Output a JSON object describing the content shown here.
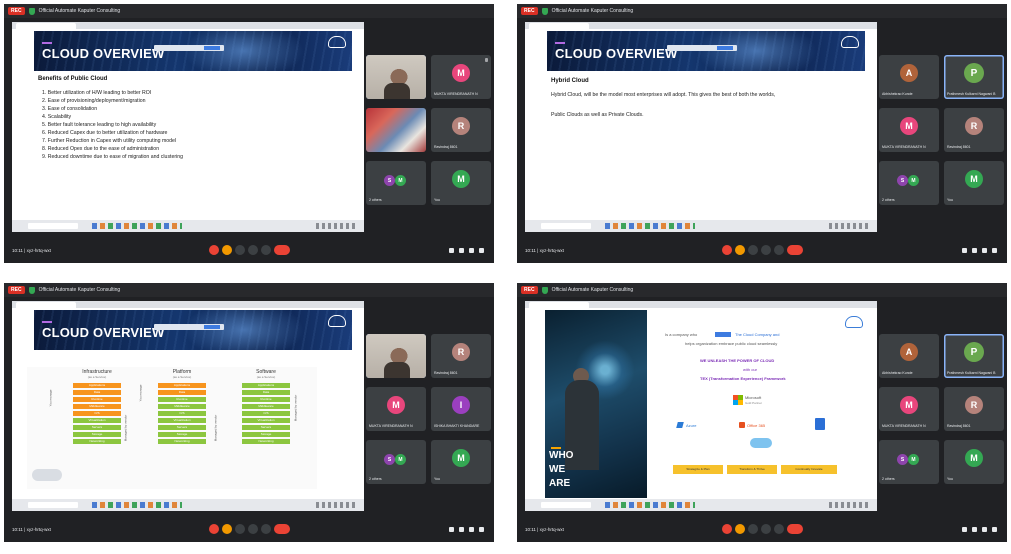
{
  "meeting": {
    "rec_label": "REC",
    "title": "Official Automate Kaputer Consulting",
    "time": "10:11  |  xyz-hrtq-wxt"
  },
  "panels": [
    {
      "slide_title": "CLOUD OVERVIEW",
      "heading": "Benefits of Public Cloud",
      "bullets": [
        "1. Better utilization of H/W leading to better ROI",
        "2. Ease of provisioning/deployment/migration",
        "3. Ease of consolidation",
        "4. Scalability",
        "5. Better fault tolerance leading to high availability",
        "6. Reduced Capex due to better utilization of hardware",
        "7. Further Reduction in Capex with utility computing model",
        "8. Reduced Opex due to the ease of administration",
        "9. Reduced downtime due to ease of migration and clustering"
      ],
      "participants": [
        {
          "name": "",
          "type": "video"
        },
        {
          "initial": "M",
          "name": "MUKTA VIRENDRANATH N",
          "color": "#e8467c"
        },
        {
          "name": "",
          "type": "video2"
        },
        {
          "initial": "R",
          "name": "Ravindraj 8601",
          "color": "#b5837b"
        },
        {
          "initial": "S",
          "initial2": "M",
          "name": "2 others",
          "color": "#8e44ad"
        },
        {
          "initial": "M",
          "name": "You",
          "color": "#34a853"
        }
      ]
    },
    {
      "slide_title": "CLOUD OVERVIEW",
      "heading": "Hybrid Cloud",
      "paragraphs": [
        "Hybrid Cloud, will be the model most enterprises will adopt. This gives the best of both the worlds,",
        "Public Clouds as well as Private Clouds."
      ],
      "participants": [
        {
          "initial": "A",
          "name": "Abhishekrao Kunde",
          "color": "#b0633a"
        },
        {
          "initial": "P",
          "name": "Prathmesh Kulkarni Nagwani B",
          "color": "#6aa84f"
        },
        {
          "initial": "M",
          "name": "MUKTA VIRENDRANATH N",
          "color": "#e8467c"
        },
        {
          "initial": "R",
          "name": "Ravindraj 8601",
          "color": "#b5837b"
        },
        {
          "initial": "S",
          "initial2": "M",
          "name": "2 others",
          "color": "#8e44ad"
        },
        {
          "initial": "M",
          "name": "You",
          "color": "#34a853"
        }
      ]
    },
    {
      "slide_title": "CLOUD OVERVIEW",
      "columns": [
        {
          "head": "Infrastructure",
          "sub": "(as a Service)",
          "items": [
            "Applications",
            "Data",
            "Runtime",
            "Middleware",
            "O/S",
            "Virtualization",
            "Servers",
            "Storage",
            "Networking"
          ],
          "orange_count": 5
        },
        {
          "head": "Platform",
          "sub": "(as a Service)",
          "items": [
            "Applications",
            "Data",
            "Runtime",
            "Middleware",
            "O/S",
            "Virtualization",
            "Servers",
            "Storage",
            "Networking"
          ],
          "orange_count": 2
        },
        {
          "head": "Software",
          "sub": "(as a Service)",
          "items": [
            "Applications",
            "Data",
            "Runtime",
            "Middleware",
            "O/S",
            "Virtualization",
            "Servers",
            "Storage",
            "Networking"
          ],
          "orange_count": 0
        }
      ],
      "side_labels": [
        "You manage",
        "Managed by vendor",
        "You manage",
        "Managed by vendor",
        "Managed by vendor"
      ],
      "participants": [
        {
          "name": "",
          "type": "video"
        },
        {
          "initial": "R",
          "name": "Ravindraj 8601",
          "color": "#b5837b"
        },
        {
          "initial": "M",
          "name": "MUKTA VIRENDRANATH N",
          "color": "#e8467c"
        },
        {
          "initial": "I",
          "name": "ISHIKA BHAKTI KHANDARE",
          "color": "#9b3fbf"
        },
        {
          "initial": "S",
          "initial2": "M",
          "name": "2 others",
          "color": "#8e44ad"
        },
        {
          "initial": "M",
          "name": "You",
          "color": "#34a853"
        }
      ]
    },
    {
      "who_words": [
        "WHO",
        "WE",
        "ARE"
      ],
      "intro_a": "Is a company who",
      "intro_b": "The Cloud Company and",
      "intro_c": "helps organization embrace public cloud seamlessly",
      "power": "WE UNLEASH THE POWER OF CLOUD",
      "with_our": "with our",
      "tex": "TEX (Transformation Experience) Framework",
      "partner1": "Microsoft",
      "partner1_sub": "Gold Partner",
      "azure": "Azure",
      "office": "Office 365",
      "buttons": [
        "Strategize & Plan",
        "Transform & Thrive",
        "Continually Innovate"
      ],
      "participants": [
        {
          "initial": "A",
          "name": "Abhishekrao Kunde",
          "color": "#b0633a"
        },
        {
          "initial": "P",
          "name": "Prathmesh Kulkarni Nagwani B",
          "color": "#6aa84f"
        },
        {
          "initial": "M",
          "name": "MUKTA VIRENDRANATH N",
          "color": "#e8467c"
        },
        {
          "initial": "R",
          "name": "Ravindraj 8601",
          "color": "#b5837b"
        },
        {
          "initial": "S",
          "initial2": "M",
          "name": "2 others",
          "color": "#8e44ad"
        },
        {
          "initial": "M",
          "name": "You",
          "color": "#34a853"
        }
      ]
    }
  ]
}
